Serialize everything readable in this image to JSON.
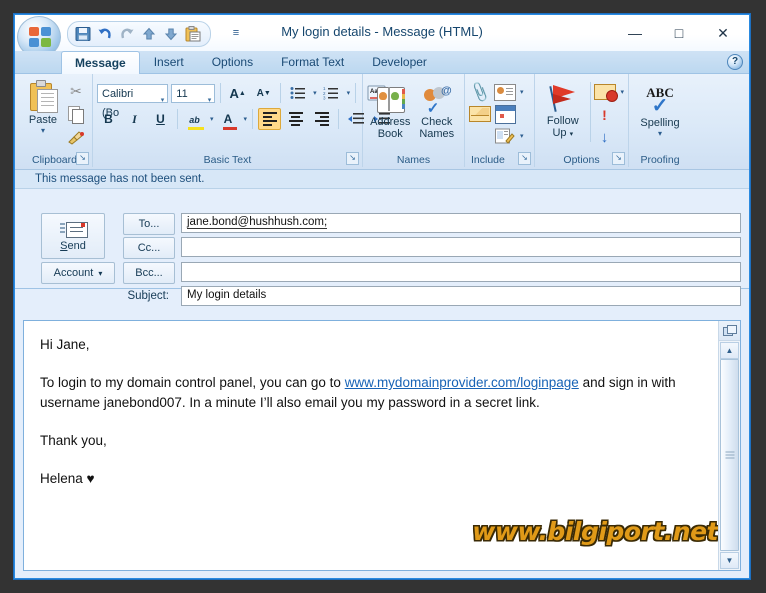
{
  "window": {
    "title": "My login details - Message (HTML)",
    "minimize_label": "—",
    "maximize_label": "□",
    "close_label": "✕"
  },
  "office_button": {
    "name": "Office Button"
  },
  "quick_access": {
    "items": [
      {
        "icon": "save-icon",
        "label": "Save"
      },
      {
        "icon": "undo-icon",
        "label": "Undo"
      },
      {
        "icon": "redo-icon",
        "label": "Redo"
      },
      {
        "icon": "previous-item-icon",
        "label": "Previous Item"
      },
      {
        "icon": "next-item-icon",
        "label": "Next Item"
      },
      {
        "icon": "paste-icon",
        "label": "Paste"
      }
    ],
    "more_label": "≡"
  },
  "tabs": [
    {
      "label": "Message",
      "active": true
    },
    {
      "label": "Insert",
      "active": false
    },
    {
      "label": "Options",
      "active": false
    },
    {
      "label": "Format Text",
      "active": false
    },
    {
      "label": "Developer",
      "active": false
    }
  ],
  "help_label": "?",
  "ribbon": {
    "groups": [
      {
        "name": "Clipboard",
        "label": "Clipboard",
        "paste_label": "Paste",
        "paste_caret": "▾",
        "cut_label": "Cut",
        "copy_label": "Copy",
        "format_painter_label": "Format Painter",
        "cut_glyph": "✂",
        "brush_glyph": "🖌"
      },
      {
        "name": "Basic Text",
        "label": "Basic Text",
        "font_name": "Calibri (Bo",
        "font_size": "11",
        "grow_font": "A",
        "shrink_font": "A",
        "bullets_label": "Bullets",
        "numbering_label": "Numbering",
        "clear_formatting": "Clear Formatting",
        "bold": "B",
        "italic": "I",
        "underline": "U",
        "highlight": "ab",
        "font_color": "A",
        "align_left": "Align Left",
        "align_center": "Center",
        "align_right": "Align Right",
        "decrease_indent": "Decrease Indent",
        "increase_indent": "Increase Indent",
        "caret": "▾"
      },
      {
        "name": "Names",
        "label": "Names",
        "address_book_line1": "Address",
        "address_book_line2": "Book",
        "check_names_line1": "Check",
        "check_names_line2": "Names"
      },
      {
        "name": "Include",
        "label": "Include",
        "attach_file_label": "Attach File",
        "business_card_label": "Business Card",
        "attach_item_label": "Attach Item",
        "calendar_label": "Calendar",
        "signature_label": "Signature",
        "caret": "▾"
      },
      {
        "name": "Options",
        "label": "Options",
        "follow_up_line1": "Follow",
        "follow_up_line2": "Up",
        "permission_label": "Permission",
        "high_importance": "!",
        "low_importance": "↓",
        "caret": "▾"
      },
      {
        "name": "Proofing",
        "label": "Proofing",
        "spelling_abc": "ABC",
        "spelling_label": "Spelling",
        "caret": "▾"
      }
    ],
    "dialog_launcher": "↘"
  },
  "info_bar": {
    "text": "This message has not been sent."
  },
  "compose": {
    "send_label": "Send",
    "send_accesskey": "S",
    "account_label": "Account",
    "account_caret": "▾",
    "to_label": "To...",
    "cc_label": "Cc...",
    "bcc_label": "Bcc...",
    "subject_label": "Subject:",
    "to_value": "jane.bond@hushhush.com;",
    "cc_value": "",
    "bcc_value": "",
    "subject_value": "My login details"
  },
  "message_body": {
    "greeting": "Hi Jane,",
    "paragraph_before_link": "To login to my domain control panel, you can go to ",
    "link_text": "www.mydomainprovider.com/loginpage",
    "paragraph_after_link": " and sign in with username janebond007. In a minute I’ll also email you my password in a secret link.",
    "closing": "Thank you,",
    "signature": "Helena ♥",
    "watermark": "www.bilgiport.net"
  },
  "scrollbar": {
    "split_label": "Split",
    "up_label": "▲",
    "down_label": "▼"
  },
  "colors": {
    "window_border": "#2a8ae0",
    "ribbon_bg": "#dbe9f8",
    "pane_bg": "#e4eefb",
    "link": "#1763b6",
    "watermark": "#e09a18",
    "desktop": "#333333"
  }
}
